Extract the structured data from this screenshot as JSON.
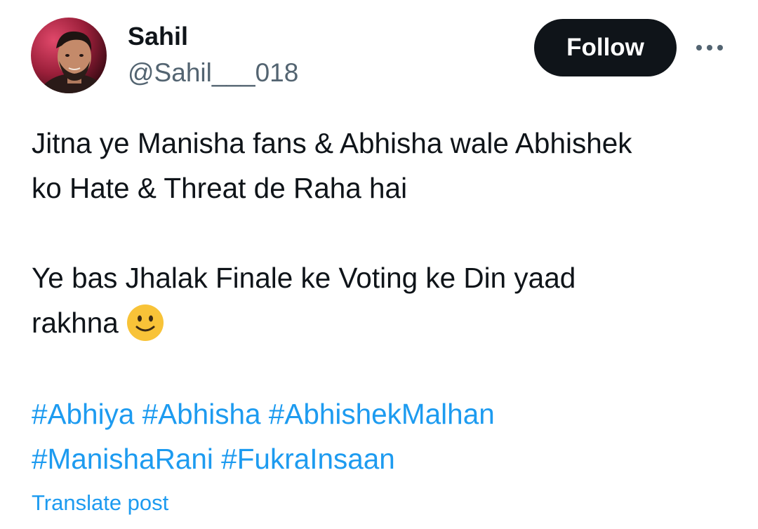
{
  "author": {
    "display_name": "Sahil",
    "handle": "@Sahil___018"
  },
  "header": {
    "follow_label": "Follow",
    "more_icon": "more-horizontal-icon"
  },
  "post": {
    "paragraph_1_line_1": "Jitna ye Manisha fans & Abhisha wale Abhishek",
    "paragraph_1_line_2": "ko Hate & Threat de Raha hai",
    "paragraph_2_line_1": "Ye bas Jhalak Finale ke Voting ke Din yaad",
    "paragraph_2_line_2": "rakhna",
    "emoji": "slightly-smiling-face-emoji",
    "hashtags": [
      "#Abhiya",
      "#Abhisha",
      "#AbhishekMalhan",
      "#ManishaRani",
      "#FukraInsaan"
    ],
    "translate_label": "Translate post"
  },
  "colors": {
    "text": "#0f1419",
    "secondary": "#536471",
    "link": "#1d9bf0",
    "follow_bg": "#0f1419",
    "emoji": "#f8c338"
  }
}
